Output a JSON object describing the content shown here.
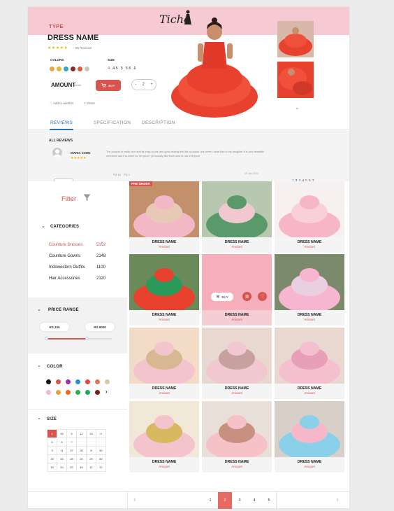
{
  "header": {
    "logo_text": "Tiche",
    "type_label": "TYPE",
    "product_name": "DRESS NAME",
    "stars": "★★★★★",
    "reviews_count": "55 Reviews",
    "colors_label": "COLORS",
    "size_label": "SIZE",
    "sizes": [
      "4",
      "4.5",
      "5",
      "5.5",
      "6"
    ],
    "colors": [
      "#e6a94a",
      "#e6b83a",
      "#3aa0c9",
      "#8b2a2a",
      "#d9603b",
      "#c8c8b8"
    ],
    "amount_label": "AMOUNT",
    "amount_value": "####",
    "buy_label": "BUY",
    "qty_minus": "-",
    "qty_value": "2",
    "qty_plus": "+",
    "wishlist_label": "Add to wishlist",
    "share_label": "Share"
  },
  "tabs": [
    "REVIEWS",
    "SPECIFICATION",
    "DESCRIPTION"
  ],
  "reviews": {
    "title": "ALL REVIEWS",
    "name": "MARIA JOHN",
    "stars": "★★★★★",
    "text": "The product is really nice and its easy to use and good asking feel like a unique one when I wear this to my daughter it is very beautiful members and it is worth for the price i personally like this brand to use everyone",
    "date": "05 July 2020",
    "likes": "10",
    "dislikes": "2",
    "pages": [
      "1",
      "2",
      "3",
      "4",
      "5",
      "6",
      "7"
    ],
    "active_page": "2"
  },
  "sidebar": {
    "filter_label": "Filter",
    "categories_title": "CATEGORIES",
    "categories": [
      {
        "name": "Counture Dresses",
        "count": "5152"
      },
      {
        "name": "Counture Gowns",
        "count": "2148"
      },
      {
        "name": "Indowestern Outfits",
        "count": "1100"
      },
      {
        "name": "Hair Accessories",
        "count": "2110"
      }
    ],
    "price_title": "PRICE RANGE",
    "price_min": "RS.100",
    "price_max": "RS.9000",
    "color_title": "COLOR",
    "swatches_row1": [
      "#111111",
      "#d9534f",
      "#9a2fa8",
      "#2a8fd6",
      "#e8453c",
      "#d97a4b",
      "#d9c9a8"
    ],
    "swatches_row2": [
      "#f2b8c6",
      "#e8a33a",
      "#e86a1a",
      "#2ab04a",
      "#1fa35a",
      "#7a1a1a"
    ],
    "more_arrow": "›",
    "size_title": "SIZE",
    "sizes": [
      "4",
      "45",
      "6",
      "12",
      "24",
      "6",
      "6",
      "5",
      "7",
      "",
      "",
      "",
      "3",
      "11",
      "37",
      "38",
      "8",
      "40",
      "16",
      "16",
      "28",
      "24",
      "29",
      "60",
      "16",
      "20",
      "62",
      "45",
      "21",
      "37"
    ]
  },
  "products": [
    {
      "name": "DRESS NAME",
      "amount": "Amount",
      "badge": "PRE ORDER"
    },
    {
      "name": "DRESS NAME",
      "amount": "Amount"
    },
    {
      "name": "DRESS NAME",
      "amount": "Amount"
    },
    {
      "name": "DRESS NAME",
      "amount": "Amount"
    },
    {
      "name": "DRESS NAME",
      "amount": "Amount",
      "buy": "BUY"
    },
    {
      "name": "DRESS NAME",
      "amount": "Amount"
    },
    {
      "name": "DRESS NAME",
      "amount": "Amount"
    },
    {
      "name": "DRESS NAME",
      "amount": "Amount"
    },
    {
      "name": "DRESS NAME",
      "amount": "Amount"
    },
    {
      "name": "DRESS NAME",
      "amount": "Amount"
    },
    {
      "name": "DRESS NAME",
      "amount": "Amount"
    },
    {
      "name": "DRESS NAME",
      "amount": "Amount"
    }
  ],
  "pagination": {
    "prev": "‹",
    "next": "›",
    "pages": [
      "1",
      "2",
      "3",
      "4",
      "5"
    ],
    "active": "2"
  },
  "accent": "#d9534f"
}
